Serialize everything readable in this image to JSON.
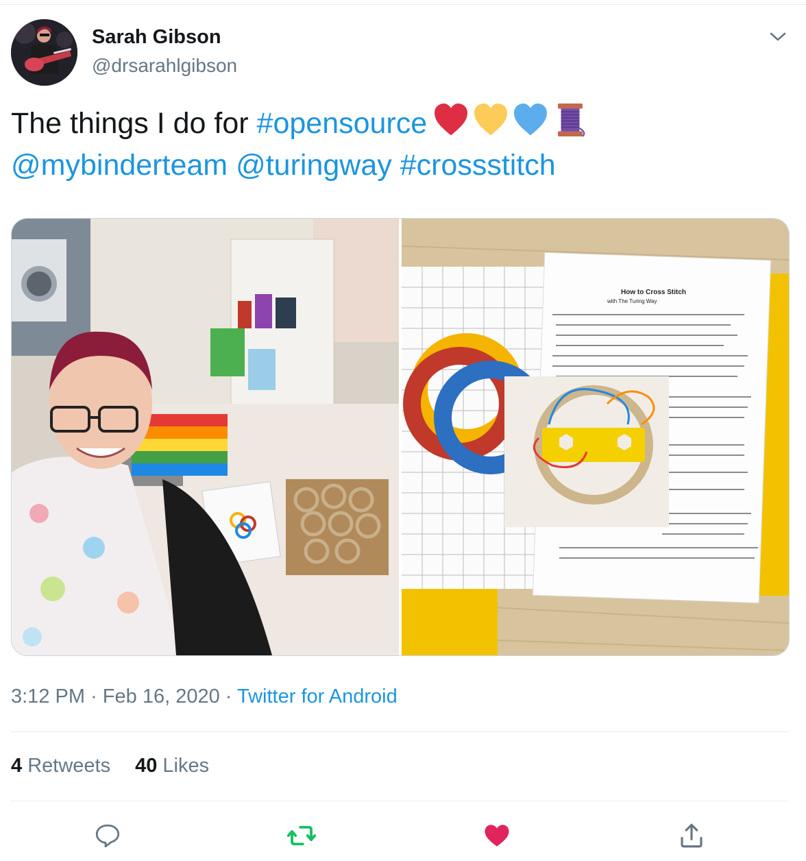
{
  "user": {
    "name": "Sarah Gibson",
    "handle": "@drsarahlgibson"
  },
  "tweet": {
    "text_plain": "The things I do for ",
    "hashtag_1": "#opensource",
    "mention_1": "@mybinderteam",
    "mention_2": "@turingway",
    "hashtag_2": "#crossstitch",
    "emojis": [
      "red-heart",
      "yellow-heart",
      "blue-heart",
      "thread-spool"
    ]
  },
  "media": {
    "photos": [
      {
        "description_icon": "photo-crafts-room"
      },
      {
        "description_icon": "photo-cross-stitch-kit"
      }
    ],
    "document": {
      "title": "How to Cross Stitch",
      "subtitle": "with The Turing Way"
    }
  },
  "meta": {
    "time": "3:12 PM",
    "separator": "·",
    "date": "Feb 16, 2020",
    "source": "Twitter for Android"
  },
  "stats": {
    "retweets_count": "4",
    "retweets_label": "Retweets",
    "likes_count": "40",
    "likes_label": "Likes"
  },
  "colors": {
    "link": "#1b95e0",
    "retweet_active": "#17bf63",
    "like_active": "#e0245e",
    "muted": "#657786"
  }
}
